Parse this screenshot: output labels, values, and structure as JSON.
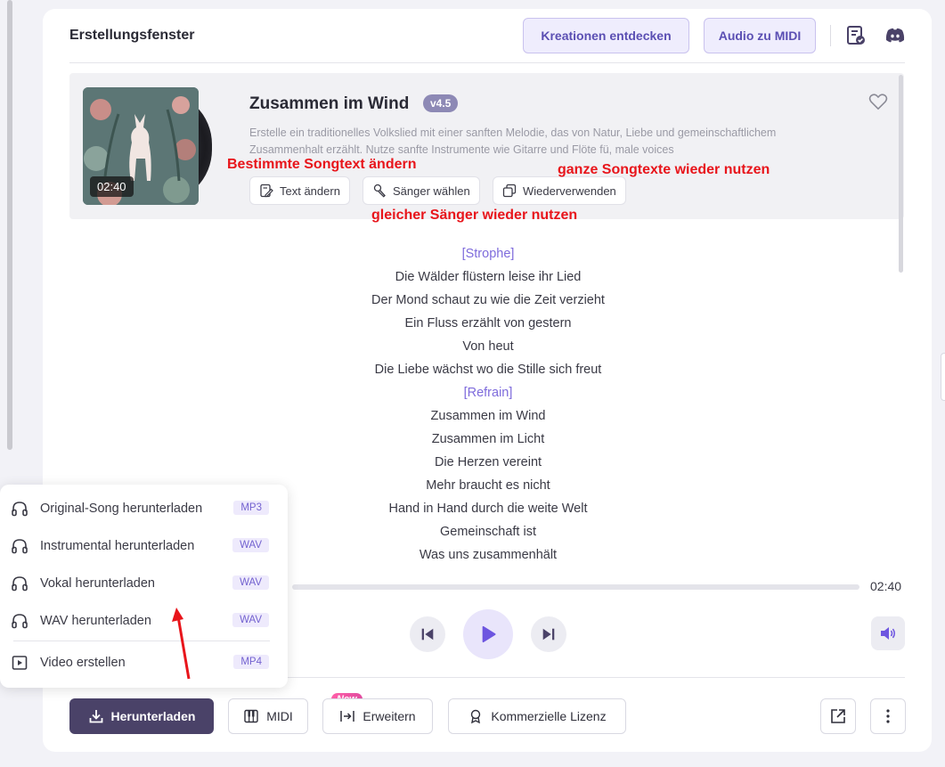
{
  "header": {
    "title": "Erstellungsfenster",
    "discover_label": "Kreationen entdecken",
    "midi_label": "Audio zu MIDI",
    "icons": [
      "task-list-icon",
      "discord-icon"
    ]
  },
  "song": {
    "title": "Zusammen im Wind",
    "version": "v4.5",
    "duration": "02:40",
    "description": "Erstelle ein traditionelles Volkslied mit einer sanften Melodie, das von Natur, Liebe und gemeinschaftlichem Zusammenhalt erzählt. Nutze sanfte Instrumente wie Gitarre und Flöte fü, male voices",
    "actions": {
      "edit_text": "Text ändern",
      "choose_singer": "Sänger wählen",
      "reuse": "Wiederverwenden"
    }
  },
  "annotations": {
    "edit": "Bestimmte Songtext ändern",
    "reuse": "ganze Songtexte wieder nutzen",
    "singer": "gleicher Sänger wieder nutzen"
  },
  "lyrics": [
    {
      "text": "[Strophe]",
      "section": true
    },
    {
      "text": "Die Wälder flüstern leise ihr Lied",
      "section": false
    },
    {
      "text": "Der Mond schaut zu wie die Zeit verzieht",
      "section": false
    },
    {
      "text": "Ein Fluss erzählt von gestern",
      "section": false
    },
    {
      "text": "Von heut",
      "section": false
    },
    {
      "text": "Die Liebe wächst wo die Stille sich freut",
      "section": false
    },
    {
      "text": "[Refrain]",
      "section": true
    },
    {
      "text": "Zusammen im Wind",
      "section": false
    },
    {
      "text": "Zusammen im Licht",
      "section": false
    },
    {
      "text": "Die Herzen vereint",
      "section": false
    },
    {
      "text": "Mehr braucht es nicht",
      "section": false
    },
    {
      "text": "Hand in Hand durch die weite Welt",
      "section": false
    },
    {
      "text": "Gemeinschaft ist",
      "section": false
    },
    {
      "text": "Was uns zusammenhält",
      "section": false
    }
  ],
  "player": {
    "end_time": "02:40",
    "progress": 0
  },
  "download_menu": {
    "items": [
      {
        "label": "Original-Song herunterladen",
        "format": "MP3"
      },
      {
        "label": "Instrumental herunterladen",
        "format": "WAV"
      },
      {
        "label": "Vokal herunterladen",
        "format": "WAV"
      },
      {
        "label": "WAV herunterladen",
        "format": "WAV"
      },
      {
        "label": "Video erstellen",
        "format": "MP4"
      }
    ]
  },
  "bottom_bar": {
    "download": "Herunterladen",
    "midi": "MIDI",
    "new_badge": "New",
    "extend": "Erweitern",
    "license": "Kommerzielle Lizenz"
  },
  "colors": {
    "accent": "#7e6bdc",
    "download_button": "#4a4268",
    "annotation": "#e8151b"
  }
}
